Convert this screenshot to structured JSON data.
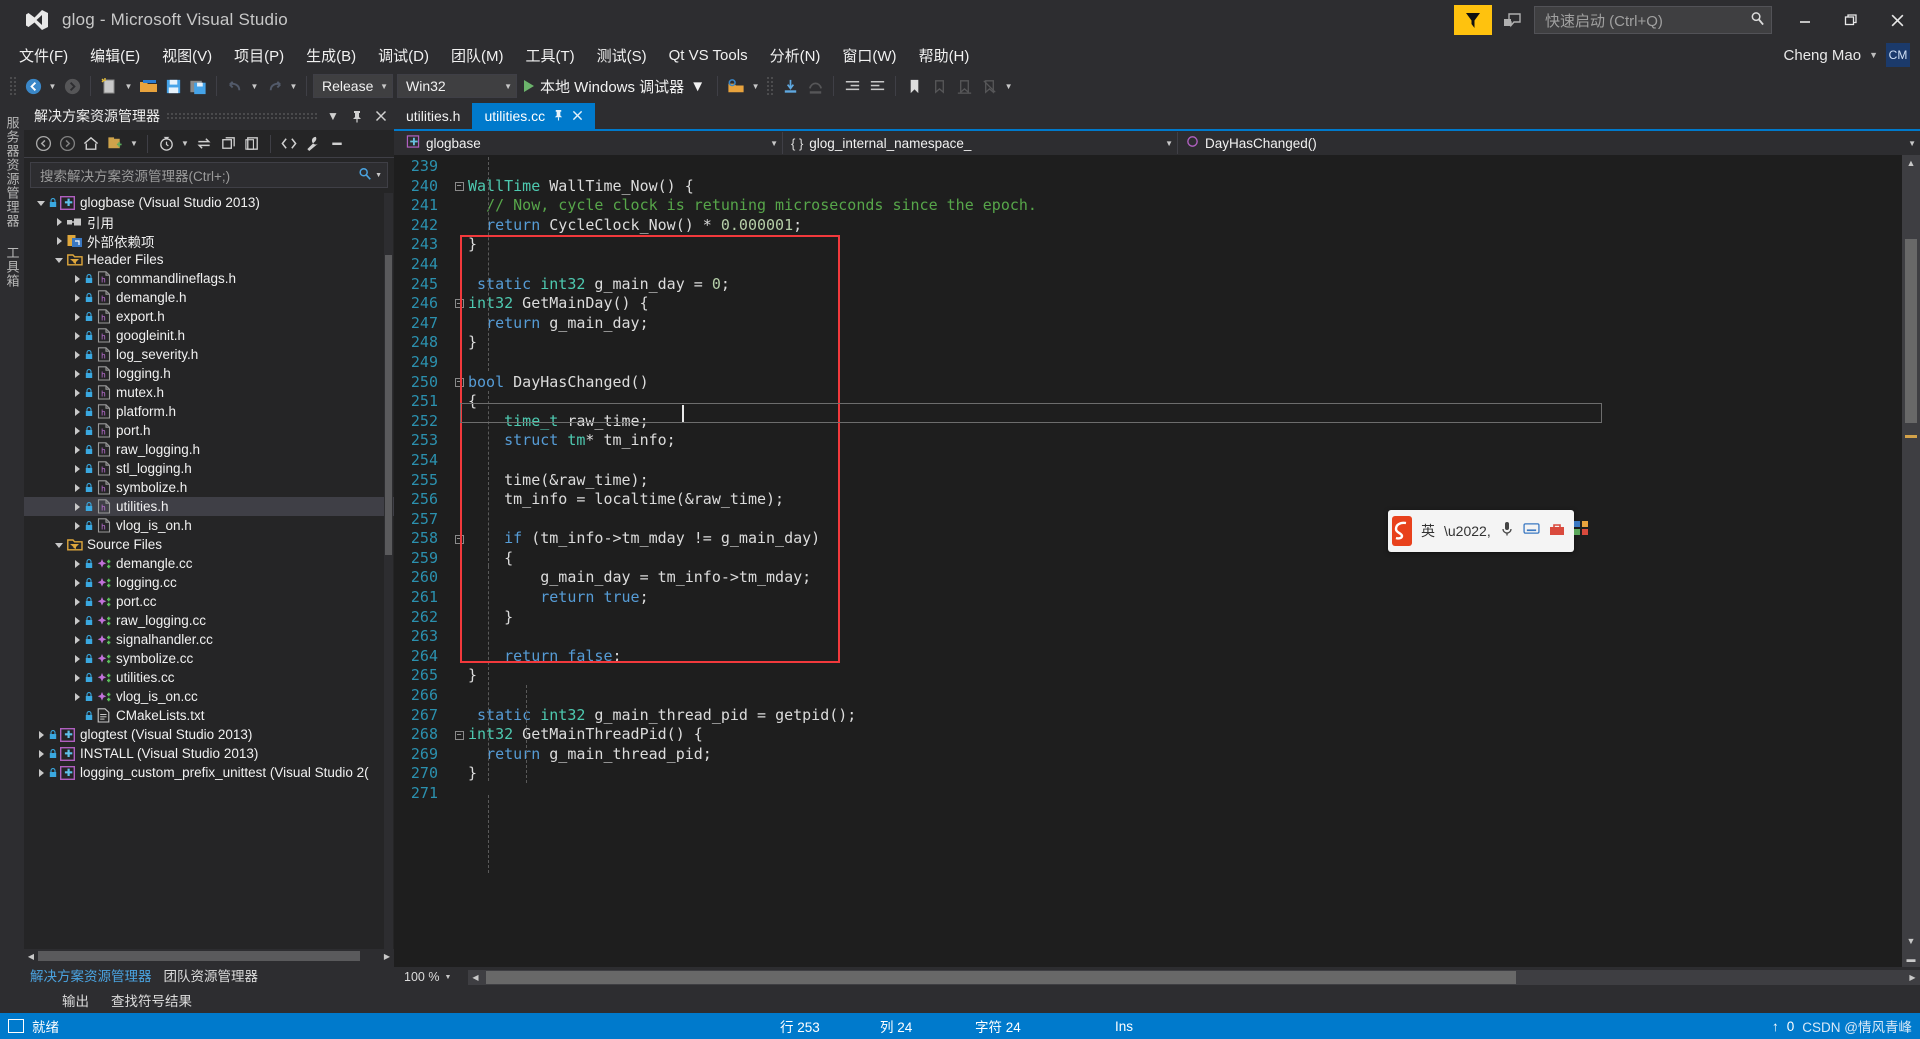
{
  "window": {
    "title": "glog - Microsoft Visual Studio",
    "logo_icon": "visual-studio-logo",
    "minimize_label": "—",
    "maximize_label": "❐",
    "close_label": "✕"
  },
  "titlebar": {
    "feedback_icon": "feedback-funnel-icon",
    "notify_icon": "notification-balloon-icon",
    "quick_launch_placeholder": "快速启动 (Ctrl+Q)",
    "quick_launch_value": "",
    "search_icon": "search-icon"
  },
  "menu": {
    "items": [
      {
        "label": "文件(F)",
        "name": "menu-file"
      },
      {
        "label": "编辑(E)",
        "name": "menu-edit"
      },
      {
        "label": "视图(V)",
        "name": "menu-view"
      },
      {
        "label": "项目(P)",
        "name": "menu-project"
      },
      {
        "label": "生成(B)",
        "name": "menu-build"
      },
      {
        "label": "调试(D)",
        "name": "menu-debug"
      },
      {
        "label": "团队(M)",
        "name": "menu-team"
      },
      {
        "label": "工具(T)",
        "name": "menu-tools"
      },
      {
        "label": "测试(S)",
        "name": "menu-test"
      },
      {
        "label": "Qt VS Tools",
        "name": "menu-qt-vs-tools"
      },
      {
        "label": "分析(N)",
        "name": "menu-analyze"
      },
      {
        "label": "窗口(W)",
        "name": "menu-window"
      },
      {
        "label": "帮助(H)",
        "name": "menu-help"
      }
    ],
    "user_name": "Cheng Mao",
    "user_initials": "CM"
  },
  "toolbar": {
    "nav_back_icon": "navigate-back-icon",
    "nav_forward_icon": "navigate-forward-icon",
    "new_item_icon": "new-item-icon",
    "open_icon": "open-file-icon",
    "save_icon": "save-icon",
    "save_all_icon": "save-all-icon",
    "undo_icon": "undo-icon",
    "redo_icon": "redo-icon",
    "configuration": "Release",
    "platform": "Win32",
    "debug_target": "本地 Windows 调试器",
    "run_icon": "play-icon"
  },
  "docked_tabs": [
    {
      "label": "服务器资源管理器",
      "name": "dock-tab-server-explorer"
    },
    {
      "label": "工具箱",
      "name": "dock-tab-toolbox"
    }
  ],
  "solution_explorer": {
    "title": "解决方案资源管理器",
    "dropdown_icon": "chevron-down-icon",
    "pin_icon": "pin-icon",
    "close_icon": "close-icon",
    "search_placeholder": "搜索解决方案资源管理器(Ctrl+;)",
    "search_value": "",
    "search_icon": "search-icon",
    "toolbar_icons": [
      "back-icon",
      "forward-icon",
      "home-icon",
      "new-folder-icon",
      "dropdown-icon",
      "pending-changes-icon",
      "dropdown2-icon",
      "sync-icon",
      "collapse-all-icon",
      "properties-icon",
      "show-all-files-icon",
      "wrench-icon",
      "minus-icon"
    ],
    "footer_tabs": [
      {
        "label": "解决方案资源管理器",
        "active": true,
        "name": "footer-tab-solution-explorer"
      },
      {
        "label": "团队资源管理器",
        "active": false,
        "name": "footer-tab-team-explorer"
      }
    ],
    "tree": [
      {
        "label": "glogbase (Visual Studio 2013)",
        "depth": 0,
        "expander": "open",
        "icon": "project-icon",
        "lock": true,
        "selected": false
      },
      {
        "label": "引用",
        "depth": 1,
        "expander": "closed",
        "icon": "references-icon",
        "lock": false,
        "selected": false
      },
      {
        "label": "外部依赖项",
        "depth": 1,
        "expander": "closed",
        "icon": "external-deps-icon",
        "lock": false,
        "selected": false
      },
      {
        "label": "Header Files",
        "depth": 1,
        "expander": "open",
        "icon": "filter-folder-icon",
        "lock": false,
        "selected": false
      },
      {
        "label": "commandlineflags.h",
        "depth": 2,
        "expander": "closed",
        "icon": "header-file-icon",
        "lock": true,
        "selected": false
      },
      {
        "label": "demangle.h",
        "depth": 2,
        "expander": "closed",
        "icon": "header-file-icon",
        "lock": true,
        "selected": false
      },
      {
        "label": "export.h",
        "depth": 2,
        "expander": "closed",
        "icon": "header-file-icon",
        "lock": true,
        "selected": false
      },
      {
        "label": "googleinit.h",
        "depth": 2,
        "expander": "closed",
        "icon": "header-file-icon",
        "lock": true,
        "selected": false
      },
      {
        "label": "log_severity.h",
        "depth": 2,
        "expander": "closed",
        "icon": "header-file-icon",
        "lock": true,
        "selected": false
      },
      {
        "label": "logging.h",
        "depth": 2,
        "expander": "closed",
        "icon": "header-file-icon",
        "lock": true,
        "selected": false
      },
      {
        "label": "mutex.h",
        "depth": 2,
        "expander": "closed",
        "icon": "header-file-icon",
        "lock": true,
        "selected": false
      },
      {
        "label": "platform.h",
        "depth": 2,
        "expander": "closed",
        "icon": "header-file-icon",
        "lock": true,
        "selected": false
      },
      {
        "label": "port.h",
        "depth": 2,
        "expander": "closed",
        "icon": "header-file-icon",
        "lock": true,
        "selected": false
      },
      {
        "label": "raw_logging.h",
        "depth": 2,
        "expander": "closed",
        "icon": "header-file-icon",
        "lock": true,
        "selected": false
      },
      {
        "label": "stl_logging.h",
        "depth": 2,
        "expander": "closed",
        "icon": "header-file-icon",
        "lock": true,
        "selected": false
      },
      {
        "label": "symbolize.h",
        "depth": 2,
        "expander": "closed",
        "icon": "header-file-icon",
        "lock": true,
        "selected": false
      },
      {
        "label": "utilities.h",
        "depth": 2,
        "expander": "closed",
        "icon": "header-file-icon",
        "lock": true,
        "selected": true
      },
      {
        "label": "vlog_is_on.h",
        "depth": 2,
        "expander": "closed",
        "icon": "header-file-icon",
        "lock": true,
        "selected": false
      },
      {
        "label": "Source Files",
        "depth": 1,
        "expander": "open",
        "icon": "filter-folder-icon",
        "lock": false,
        "selected": false
      },
      {
        "label": "demangle.cc",
        "depth": 2,
        "expander": "closed",
        "icon": "cpp-file-icon",
        "lock": true,
        "selected": false
      },
      {
        "label": "logging.cc",
        "depth": 2,
        "expander": "closed",
        "icon": "cpp-file-icon",
        "lock": true,
        "selected": false
      },
      {
        "label": "port.cc",
        "depth": 2,
        "expander": "closed",
        "icon": "cpp-file-icon",
        "lock": true,
        "selected": false
      },
      {
        "label": "raw_logging.cc",
        "depth": 2,
        "expander": "closed",
        "icon": "cpp-file-icon",
        "lock": true,
        "selected": false
      },
      {
        "label": "signalhandler.cc",
        "depth": 2,
        "expander": "closed",
        "icon": "cpp-file-icon",
        "lock": true,
        "selected": false
      },
      {
        "label": "symbolize.cc",
        "depth": 2,
        "expander": "closed",
        "icon": "cpp-file-icon",
        "lock": true,
        "selected": false
      },
      {
        "label": "utilities.cc",
        "depth": 2,
        "expander": "closed",
        "icon": "cpp-file-icon",
        "lock": true,
        "selected": false
      },
      {
        "label": "vlog_is_on.cc",
        "depth": 2,
        "expander": "closed",
        "icon": "cpp-file-icon",
        "lock": true,
        "selected": false
      },
      {
        "label": "CMakeLists.txt",
        "depth": 2,
        "expander": "none",
        "icon": "text-file-icon",
        "lock": true,
        "selected": false
      },
      {
        "label": "glogtest (Visual Studio 2013)",
        "depth": 0,
        "expander": "closed",
        "icon": "project-icon",
        "lock": true,
        "selected": false
      },
      {
        "label": "INSTALL (Visual Studio 2013)",
        "depth": 0,
        "expander": "closed",
        "icon": "project-icon",
        "lock": true,
        "selected": false
      },
      {
        "label": "logging_custom_prefix_unittest (Visual Studio 2(",
        "depth": 0,
        "expander": "closed",
        "icon": "project-icon",
        "lock": true,
        "selected": false
      }
    ]
  },
  "editor": {
    "tabs": [
      {
        "label": "utilities.h",
        "active": false,
        "name": "editor-tab-utilities-h"
      },
      {
        "label": "utilities.cc",
        "active": true,
        "name": "editor-tab-utilities-cc"
      }
    ],
    "tab_pin_icon": "pin-icon",
    "tab_close_icon": "close-icon",
    "nav_project": "glogbase",
    "nav_namespace": "glog_internal_namespace_",
    "nav_member": "DayHasChanged()",
    "zoom_level": "100 %",
    "first_line_number": 239,
    "lines": [
      {
        "n": 239,
        "fold": "",
        "tokens": [
          {
            "c": "p",
            "s": ""
          }
        ]
      },
      {
        "n": 240,
        "fold": "minus",
        "tokens": [
          {
            "c": "t",
            "s": "WallTime"
          },
          {
            "c": "p",
            "s": " WallTime_Now() {"
          }
        ]
      },
      {
        "n": 241,
        "fold": "",
        "tokens": [
          {
            "c": "p",
            "s": "  "
          },
          {
            "c": "cm",
            "s": "// Now, cycle clock is retuning microseconds since the epoch."
          }
        ]
      },
      {
        "n": 242,
        "fold": "",
        "tokens": [
          {
            "c": "p",
            "s": "  "
          },
          {
            "c": "k",
            "s": "return"
          },
          {
            "c": "p",
            "s": " CycleClock_Now() * "
          },
          {
            "c": "n",
            "s": "0.000001"
          },
          {
            "c": "p",
            "s": ";"
          }
        ]
      },
      {
        "n": 243,
        "fold": "",
        "tokens": [
          {
            "c": "p",
            "s": "}"
          }
        ]
      },
      {
        "n": 244,
        "fold": "",
        "tokens": [
          {
            "c": "p",
            "s": ""
          }
        ]
      },
      {
        "n": 245,
        "fold": "",
        "tokens": [
          {
            "c": "k",
            "s": " static"
          },
          {
            "c": "p",
            "s": " "
          },
          {
            "c": "t",
            "s": "int32"
          },
          {
            "c": "p",
            "s": " g_main_day = "
          },
          {
            "c": "n",
            "s": "0"
          },
          {
            "c": "p",
            "s": ";"
          }
        ]
      },
      {
        "n": 246,
        "fold": "minus",
        "tokens": [
          {
            "c": "t",
            "s": "int32"
          },
          {
            "c": "p",
            "s": " GetMainDay() {"
          }
        ]
      },
      {
        "n": 247,
        "fold": "",
        "tokens": [
          {
            "c": "p",
            "s": "  "
          },
          {
            "c": "k",
            "s": "return"
          },
          {
            "c": "p",
            "s": " g_main_day;"
          }
        ]
      },
      {
        "n": 248,
        "fold": "",
        "tokens": [
          {
            "c": "p",
            "s": "}"
          }
        ]
      },
      {
        "n": 249,
        "fold": "",
        "tokens": [
          {
            "c": "p",
            "s": ""
          }
        ]
      },
      {
        "n": 250,
        "fold": "minus",
        "tokens": [
          {
            "c": "k",
            "s": "bool"
          },
          {
            "c": "p",
            "s": " DayHasChanged()"
          }
        ]
      },
      {
        "n": 251,
        "fold": "",
        "tokens": [
          {
            "c": "p",
            "s": "{"
          }
        ]
      },
      {
        "n": 252,
        "fold": "",
        "tokens": [
          {
            "c": "p",
            "s": "    "
          },
          {
            "c": "t",
            "s": "time_t"
          },
          {
            "c": "p",
            "s": " raw_time;"
          }
        ]
      },
      {
        "n": 253,
        "fold": "",
        "tokens": [
          {
            "c": "p",
            "s": "    "
          },
          {
            "c": "k",
            "s": "struct"
          },
          {
            "c": "p",
            "s": " "
          },
          {
            "c": "t",
            "s": "tm"
          },
          {
            "c": "p",
            "s": "* tm_info;"
          }
        ]
      },
      {
        "n": 254,
        "fold": "",
        "tokens": [
          {
            "c": "p",
            "s": ""
          }
        ]
      },
      {
        "n": 255,
        "fold": "",
        "tokens": [
          {
            "c": "p",
            "s": "    time(&raw_time);"
          }
        ]
      },
      {
        "n": 256,
        "fold": "",
        "tokens": [
          {
            "c": "p",
            "s": "    tm_info = localtime(&raw_time);"
          }
        ]
      },
      {
        "n": 257,
        "fold": "",
        "tokens": [
          {
            "c": "p",
            "s": ""
          }
        ]
      },
      {
        "n": 258,
        "fold": "minus",
        "tokens": [
          {
            "c": "p",
            "s": "    "
          },
          {
            "c": "k",
            "s": "if"
          },
          {
            "c": "p",
            "s": " (tm_info->tm_mday != g_main_day)"
          }
        ]
      },
      {
        "n": 259,
        "fold": "",
        "tokens": [
          {
            "c": "p",
            "s": "    {"
          }
        ]
      },
      {
        "n": 260,
        "fold": "",
        "tokens": [
          {
            "c": "p",
            "s": "        g_main_day = tm_info->tm_mday;"
          }
        ]
      },
      {
        "n": 261,
        "fold": "",
        "tokens": [
          {
            "c": "p",
            "s": "        "
          },
          {
            "c": "k",
            "s": "return"
          },
          {
            "c": "p",
            "s": " "
          },
          {
            "c": "k",
            "s": "true"
          },
          {
            "c": "p",
            "s": ";"
          }
        ]
      },
      {
        "n": 262,
        "fold": "",
        "tokens": [
          {
            "c": "p",
            "s": "    }"
          }
        ]
      },
      {
        "n": 263,
        "fold": "",
        "tokens": [
          {
            "c": "p",
            "s": ""
          }
        ]
      },
      {
        "n": 264,
        "fold": "",
        "tokens": [
          {
            "c": "p",
            "s": "    "
          },
          {
            "c": "k",
            "s": "return"
          },
          {
            "c": "p",
            "s": " "
          },
          {
            "c": "k",
            "s": "false"
          },
          {
            "c": "p",
            "s": ";"
          }
        ]
      },
      {
        "n": 265,
        "fold": "",
        "tokens": [
          {
            "c": "p",
            "s": "}"
          }
        ]
      },
      {
        "n": 266,
        "fold": "",
        "tokens": [
          {
            "c": "p",
            "s": ""
          }
        ]
      },
      {
        "n": 267,
        "fold": "",
        "tokens": [
          {
            "c": "k",
            "s": " static"
          },
          {
            "c": "p",
            "s": " "
          },
          {
            "c": "t",
            "s": "int32"
          },
          {
            "c": "p",
            "s": " g_main_thread_pid = "
          },
          {
            "c": "fn",
            "s": "getpid"
          },
          {
            "c": "p",
            "s": "();"
          }
        ]
      },
      {
        "n": 268,
        "fold": "minus",
        "tokens": [
          {
            "c": "t",
            "s": "int32"
          },
          {
            "c": "p",
            "s": " GetMainThreadPid() {"
          }
        ]
      },
      {
        "n": 269,
        "fold": "",
        "tokens": [
          {
            "c": "p",
            "s": "  "
          },
          {
            "c": "k",
            "s": "return"
          },
          {
            "c": "p",
            "s": " g_main_thread_pid;"
          }
        ]
      },
      {
        "n": 270,
        "fold": "",
        "tokens": [
          {
            "c": "p",
            "s": "}"
          }
        ]
      },
      {
        "n": 271,
        "fold": "",
        "tokens": [
          {
            "c": "p",
            "s": ""
          }
        ]
      }
    ],
    "annotation": {
      "type": "red-rectangle",
      "color": "#f2393c",
      "from_line": 244,
      "to_line": 265
    }
  },
  "output_tabs": [
    {
      "label": "输出",
      "name": "output-panel-tab"
    },
    {
      "label": "查找符号结果",
      "name": "find-symbol-results-tab"
    }
  ],
  "status_bar": {
    "ready_text": "就绪",
    "ready_icon": "status-ready-icon",
    "line_label": "行 253",
    "col_label": "列 24",
    "char_label": "字符 24",
    "insert_mode": "Ins",
    "upload_icon": "upload-arrow-icon",
    "upload_count": "0",
    "watermark": "CSDN @情风青峰"
  },
  "ime_bar": {
    "logo_text": "S",
    "mode_label": "英",
    "punct_icon": "punctuation-icon",
    "mic_icon": "microphone-icon",
    "keyboard_icon": "keyboard-icon",
    "toolbox_icon": "toolbox-icon",
    "apps_icon": "apps-grid-icon"
  },
  "colors": {
    "accent": "#007acc",
    "chrome": "#2d2d30",
    "panel": "#252526",
    "editor_bg": "#1e1e1e",
    "annotation_red": "#f2393c",
    "keyword_blue": "#569cd6",
    "type_teal": "#4ec9b0",
    "comment_green": "#57a64a",
    "linenum_blue": "#2b91af",
    "feedback_yellow": "#ffc20e"
  }
}
